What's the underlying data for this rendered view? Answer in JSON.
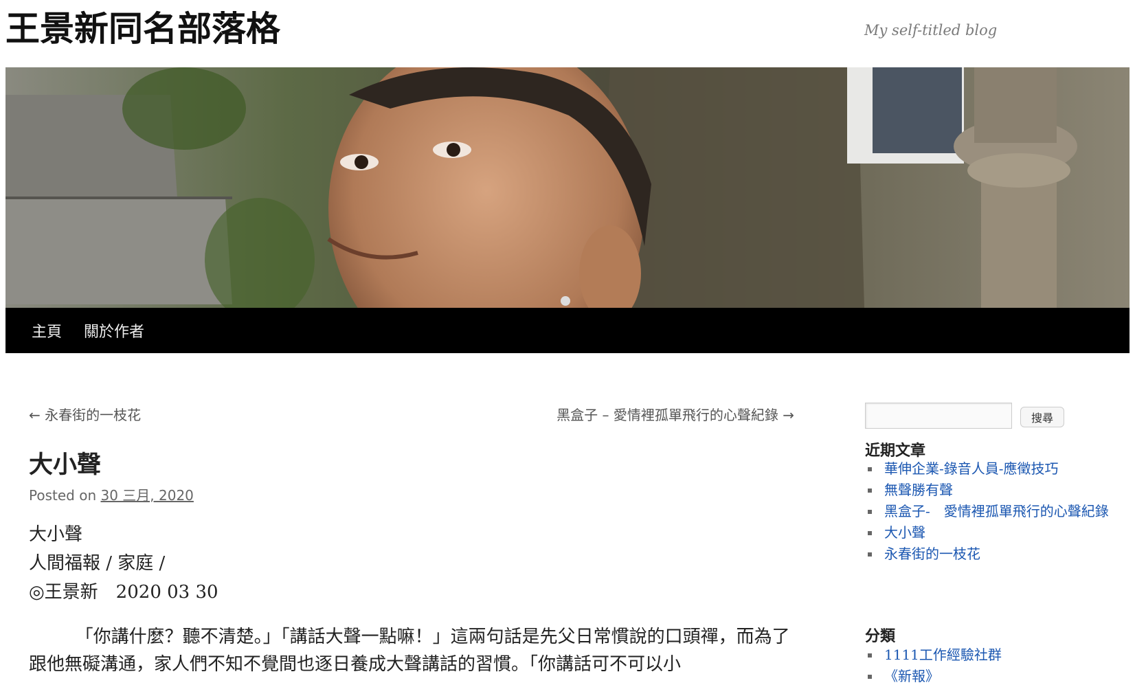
{
  "site": {
    "title": "王景新同名部落格",
    "description": "My self-titled blog"
  },
  "menu": {
    "items": [
      "主頁",
      "關於作者"
    ]
  },
  "post_nav": {
    "prev": "← 永春街的一枝花",
    "next": "黑盒子 – 愛情裡孤單飛行的心聲紀錄 →"
  },
  "post": {
    "title": "大小聲",
    "meta_prefix": "Posted on",
    "date": "30 三月, 2020",
    "lines": [
      "大小聲",
      "人間福報 / 家庭 /",
      "◎王景新　2020 03 30"
    ],
    "paragraph": "「你講什麼？聽不清楚。」「講話大聲一點嘛！」這兩句話是先父日常慣說的口頭禪，而為了跟他無礙溝通，家人們不知不覺間也逐日養成大聲講話的習慣。「你講話可不可以小"
  },
  "sidebar": {
    "search_button": "搜尋",
    "search_placeholder": "",
    "recent_title": "近期文章",
    "recent_posts": [
      "華伸企業-錄音人員-應徵技巧",
      "無聲勝有聲",
      "黑盒子-　愛情裡孤單飛行的心聲紀錄",
      "大小聲",
      "永春街的一枝花"
    ],
    "categories_title": "分類",
    "categories": [
      "1111工作經驗社群",
      "《新報》"
    ]
  },
  "colors": {
    "link": "#1b57b1",
    "nav_bar": "#000000",
    "title": "#111111"
  }
}
